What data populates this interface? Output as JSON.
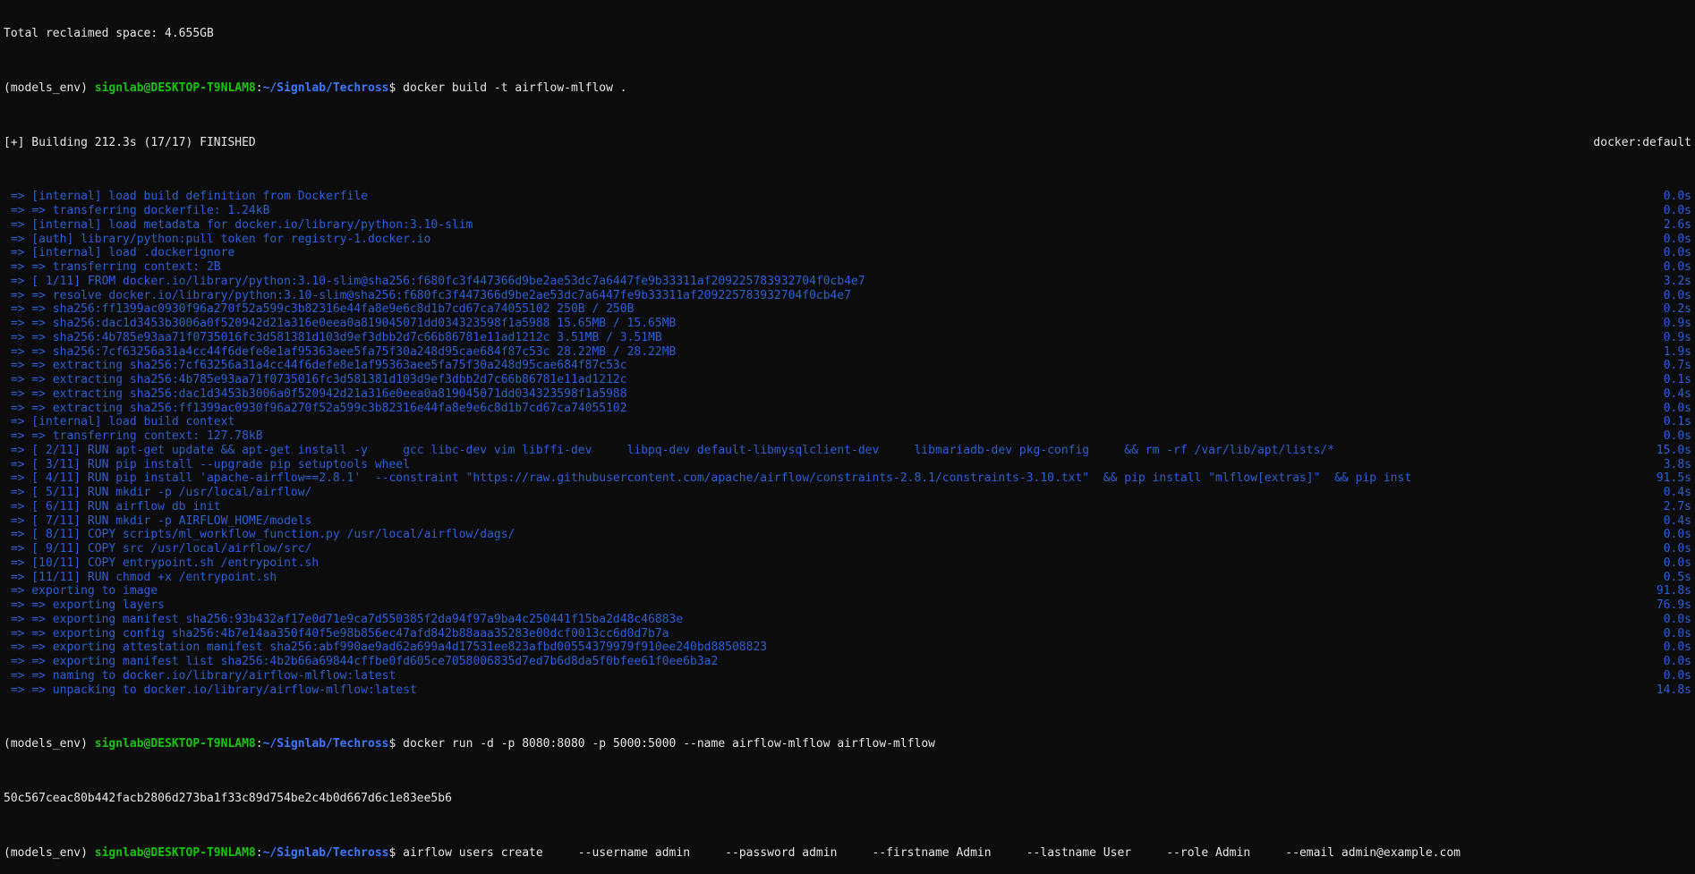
{
  "colors": {
    "background": "#0c0c0c",
    "text": "#e6e6e6",
    "build_step": "#2c5fd8",
    "prompt_user": "#16c60c",
    "prompt_path": "#3b78ff"
  },
  "prompt": {
    "env": "(models_env) ",
    "user_host": "signlab@DESKTOP-T9NLAM8",
    "colon": ":",
    "path": "~/Signlab/Techross",
    "symbol": "$ "
  },
  "reclaimed_line": "Total reclaimed space: 4.655GB",
  "build_command": "docker build -t airflow-mlflow .",
  "build_header": {
    "text": "[+] Building 212.3s (17/17) FINISHED",
    "driver": "docker:default"
  },
  "build_steps": [
    {
      "text": " => [internal] load build definition from Dockerfile",
      "time": "0.0s"
    },
    {
      "text": " => => transferring dockerfile: 1.24kB",
      "time": "0.0s"
    },
    {
      "text": " => [internal] load metadata for docker.io/library/python:3.10-slim",
      "time": "2.6s"
    },
    {
      "text": " => [auth] library/python:pull token for registry-1.docker.io",
      "time": "0.0s"
    },
    {
      "text": " => [internal] load .dockerignore",
      "time": "0.0s"
    },
    {
      "text": " => => transferring context: 2B",
      "time": "0.0s"
    },
    {
      "text": " => [ 1/11] FROM docker.io/library/python:3.10-slim@sha256:f680fc3f447366d9be2ae53dc7a6447fe9b33311af209225783932704f0cb4e7",
      "time": "3.2s"
    },
    {
      "text": " => => resolve docker.io/library/python:3.10-slim@sha256:f680fc3f447366d9be2ae53dc7a6447fe9b33311af209225783932704f0cb4e7",
      "time": "0.0s"
    },
    {
      "text": " => => sha256:ff1399ac0930f96a270f52a599c3b82316e44fa8e9e6c8d1b7cd67ca74055102 250B / 250B",
      "time": "0.2s"
    },
    {
      "text": " => => sha256:dac1d3453b3006a0f520942d21a316e0eea0a819045071dd034323598f1a5988 15.65MB / 15.65MB",
      "time": "0.9s"
    },
    {
      "text": " => => sha256:4b785e93aa71f0735016fc3d581381d103d9ef3dbb2d7c66b86781e11ad1212c 3.51MB / 3.51MB",
      "time": "0.9s"
    },
    {
      "text": " => => sha256:7cf63256a31a4cc44f6defe8e1af95363aee5fa75f30a248d95cae684f87c53c 28.22MB / 28.22MB",
      "time": "1.9s"
    },
    {
      "text": " => => extracting sha256:7cf63256a31a4cc44f6defe8e1af95363aee5fa75f30a248d95cae684f87c53c",
      "time": "0.7s"
    },
    {
      "text": " => => extracting sha256:4b785e93aa71f0735016fc3d581381d103d9ef3dbb2d7c66b86781e11ad1212c",
      "time": "0.1s"
    },
    {
      "text": " => => extracting sha256:dac1d3453b3006a0f520942d21a316e0eea0a819045071dd034323598f1a5988",
      "time": "0.4s"
    },
    {
      "text": " => => extracting sha256:ff1399ac0930f96a270f52a599c3b82316e44fa8e9e6c8d1b7cd67ca74055102",
      "time": "0.0s"
    },
    {
      "text": " => [internal] load build context",
      "time": "0.1s"
    },
    {
      "text": " => => transferring context: 127.78kB",
      "time": "0.0s"
    },
    {
      "text": " => [ 2/11] RUN apt-get update && apt-get install -y     gcc libc-dev vim libffi-dev     libpq-dev default-libmysqlclient-dev     libmariadb-dev pkg-config     && rm -rf /var/lib/apt/lists/*",
      "time": "15.0s"
    },
    {
      "text": " => [ 3/11] RUN pip install --upgrade pip setuptools wheel",
      "time": "3.8s"
    },
    {
      "text": " => [ 4/11] RUN pip install 'apache-airflow==2.8.1'  --constraint \"https://raw.githubusercontent.com/apache/airflow/constraints-2.8.1/constraints-3.10.txt\"  && pip install \"mlflow[extras]\"  && pip inst",
      "time": "91.5s"
    },
    {
      "text": " => [ 5/11] RUN mkdir -p /usr/local/airflow/",
      "time": "0.4s"
    },
    {
      "text": " => [ 6/11] RUN airflow db init",
      "time": "2.7s"
    },
    {
      "text": " => [ 7/11] RUN mkdir -p AIRFLOW_HOME/models",
      "time": "0.4s"
    },
    {
      "text": " => [ 8/11] COPY scripts/ml_workflow_function.py /usr/local/airflow/dags/",
      "time": "0.0s"
    },
    {
      "text": " => [ 9/11] COPY src /usr/local/airflow/src/",
      "time": "0.0s"
    },
    {
      "text": " => [10/11] COPY entrypoint.sh /entrypoint.sh",
      "time": "0.0s"
    },
    {
      "text": " => [11/11] RUN chmod +x /entrypoint.sh",
      "time": "0.5s"
    },
    {
      "text": " => exporting to image",
      "time": "91.8s"
    },
    {
      "text": " => => exporting layers",
      "time": "76.9s"
    },
    {
      "text": " => => exporting manifest sha256:93b432af17e0d71e9ca7d550385f2da94f97a9ba4c250441f15ba2d48c46883e",
      "time": "0.0s"
    },
    {
      "text": " => => exporting config sha256:4b7e14aa350f40f5e98b856ec47afd842b88aaa35283e00dcf0013cc6d0d7b7a",
      "time": "0.0s"
    },
    {
      "text": " => => exporting attestation manifest sha256:abf990ae9ad62a699a4d17531ee823afbd00554379979f910ee240bd88508823",
      "time": "0.0s"
    },
    {
      "text": " => => exporting manifest list sha256:4b2b66a69844cffbe0fd605ce7058006835d7ed7b6d8da5f0bfee61f0ee6b3a2",
      "time": "0.0s"
    },
    {
      "text": " => => naming to docker.io/library/airflow-mlflow:latest",
      "time": "0.0s"
    },
    {
      "text": " => => unpacking to docker.io/library/airflow-mlflow:latest",
      "time": "14.8s"
    }
  ],
  "run_command": "docker run -d -p 8080:8080 -p 5000:5000 --name airflow-mlflow airflow-mlflow",
  "container_id": "50c567ceac80b442facb2806d273ba1f33c89d754be2c4b0d667d6c1e83ee5b6",
  "users_command": "airflow users create     --username admin     --password admin     --firstname Admin     --lastname User     --role Admin     --email admin@example.com"
}
